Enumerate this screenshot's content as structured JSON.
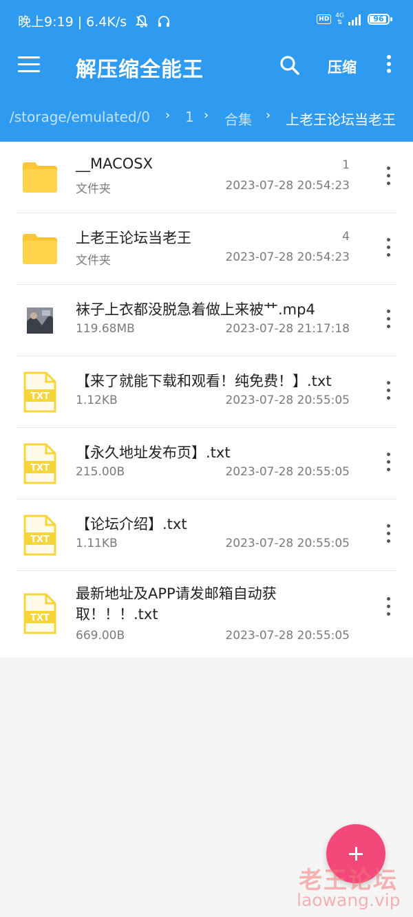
{
  "status_bar": {
    "time_speed": "晚上9:19 | 6.4K/s",
    "hd": "HD",
    "net": "4G",
    "battery": "96"
  },
  "toolbar": {
    "title": "解压缩全能王",
    "compress_label": "压缩"
  },
  "breadcrumb": {
    "path": [
      "/storage/emulated/0",
      "1",
      "合集",
      "上老王论坛当老王"
    ],
    "separator": "›"
  },
  "files": [
    {
      "name": "__MACOSX",
      "sub": "文件夹",
      "count": "1",
      "date": "2023-07-28 20:54:23",
      "type": "folder"
    },
    {
      "name": "上老王论坛当老王",
      "sub": "文件夹",
      "count": "4",
      "date": "2023-07-28 20:54:23",
      "type": "folder"
    },
    {
      "name": "袜子上衣都没脱急着做上来被艹.mp4",
      "sub": "119.68MB",
      "date": "2023-07-28 21:17:18",
      "type": "video"
    },
    {
      "name": "【来了就能下载和观看！纯免费！】.txt",
      "sub": "1.12KB",
      "date": "2023-07-28 20:55:05",
      "type": "txt"
    },
    {
      "name": "【永久地址发布页】.txt",
      "sub": "215.00B",
      "date": "2023-07-28 20:55:05",
      "type": "txt"
    },
    {
      "name": "【论坛介绍】.txt",
      "sub": "1.11KB",
      "date": "2023-07-28 20:55:05",
      "type": "txt"
    },
    {
      "name": "最新地址及APP请发邮箱自动获取！！！.txt",
      "sub": "669.00B",
      "date": "2023-07-28 20:55:05",
      "type": "txt"
    }
  ],
  "txt_icon_label": "TXT",
  "watermark": {
    "title": "老王论坛",
    "url": "laowang.vip"
  },
  "colors": {
    "accent": "#2f9bf0",
    "fab": "#f2487a",
    "folder": "#fdc634",
    "txt_icon": "#f7d43a"
  },
  "icons": {
    "menu": "hamburger-icon",
    "search": "search-icon",
    "more": "more-vertical-icon",
    "fab": "plus-icon"
  }
}
